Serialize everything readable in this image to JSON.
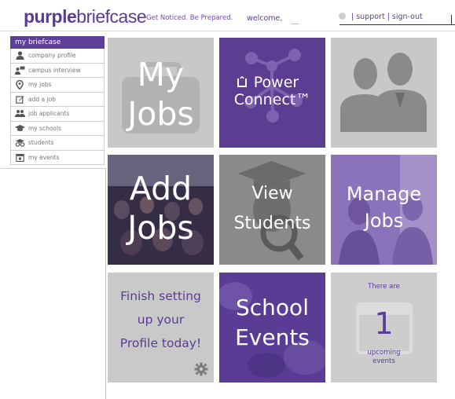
{
  "header": {
    "logo_part1": "purple",
    "logo_part2": "briefcase",
    "tagline": "Get Noticed. Be Prepared.",
    "welcome": "welcome,",
    "support": "support",
    "signout": "sign-out",
    "separator": "|"
  },
  "sidebar": {
    "title": "my briefcase",
    "items": [
      {
        "label": "company profile",
        "icon": "person-icon"
      },
      {
        "label": "campus interview",
        "icon": "interview-icon"
      },
      {
        "label": "my jobs",
        "icon": "map-pin-icon"
      },
      {
        "label": "add a job",
        "icon": "edit-icon"
      },
      {
        "label": "job applicants",
        "icon": "group-icon"
      },
      {
        "label": "my schools",
        "icon": "graduation-cap-icon"
      },
      {
        "label": "students",
        "icon": "students-icon"
      },
      {
        "label": "my events",
        "icon": "calendar-icon"
      }
    ]
  },
  "tiles": {
    "my_jobs": {
      "line1": "My",
      "line2": "Jobs"
    },
    "power_connect": {
      "line1": "Power",
      "line2": "Connect™"
    },
    "add_jobs": {
      "line1": "Add",
      "line2": "Jobs"
    },
    "view_students": {
      "line1": "View",
      "line2": "Students"
    },
    "manage_jobs": {
      "line1": "Manage",
      "line2": "Jobs"
    },
    "profile": {
      "line1": "Finish setting",
      "line2": "up your",
      "line3": "Profile today!"
    },
    "school_events": {
      "line1": "School",
      "line2": "Events"
    },
    "upcoming": {
      "prefix": "There are",
      "count": "1",
      "suffix1": "upcoming",
      "suffix2": "events"
    }
  },
  "colors": {
    "brand_purple": "#5a3c96",
    "tile_gray": "#c8c8c8"
  }
}
